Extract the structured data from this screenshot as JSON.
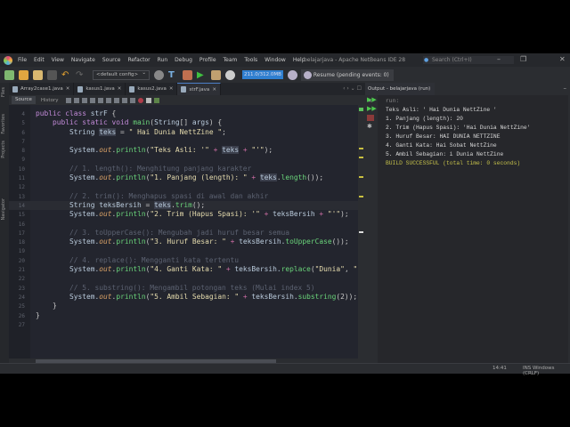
{
  "window": {
    "title": "belajarjava - Apache NetBeans IDE 28",
    "search_placeholder": "Search (Ctrl+I)"
  },
  "menu": [
    "File",
    "Edit",
    "View",
    "Navigate",
    "Source",
    "Refactor",
    "Run",
    "Debug",
    "Profile",
    "Team",
    "Tools",
    "Window",
    "Help"
  ],
  "toolbar": {
    "config": "<default config>",
    "memory": "211.0/312.0MB",
    "resume": "Resume (pending events: 0)"
  },
  "tabs": [
    {
      "label": "Array2case1.java",
      "active": false
    },
    {
      "label": "kasus1.java",
      "active": false
    },
    {
      "label": "kasus2.java",
      "active": false
    },
    {
      "label": "strF.java",
      "active": true
    }
  ],
  "editor_toolbar": {
    "source": "Source",
    "history": "History"
  },
  "left_strip": [
    "Files",
    "Favorites",
    "Projects",
    "Navigator"
  ],
  "code": [
    {
      "n": "4",
      "t": [
        [
          "k",
          "public class "
        ],
        [
          "i",
          "strF "
        ],
        [
          "p",
          "{"
        ]
      ]
    },
    {
      "n": "5",
      "t": [
        [
          "p",
          "    "
        ],
        [
          "k",
          "public static void "
        ],
        [
          "m",
          "main"
        ],
        [
          "p",
          "("
        ],
        [
          "i",
          "String"
        ],
        [
          "p",
          "[] "
        ],
        [
          "i",
          "args"
        ],
        [
          "p",
          ") {"
        ]
      ]
    },
    {
      "n": "6",
      "t": [
        [
          "p",
          "        "
        ],
        [
          "i",
          "String "
        ],
        [
          "h",
          "teks"
        ],
        [
          "p",
          " = "
        ],
        [
          "s",
          "\" Hai Dunia NettZine \""
        ],
        [
          "p",
          ";"
        ]
      ]
    },
    {
      "n": "7",
      "t": []
    },
    {
      "n": "8",
      "t": [
        [
          "p",
          "        "
        ],
        [
          "i",
          "System."
        ],
        [
          "o",
          "out"
        ],
        [
          "p",
          "."
        ],
        [
          "m",
          "println"
        ],
        [
          "p",
          "("
        ],
        [
          "s",
          "\"Teks Asli: '\""
        ],
        [
          "op",
          " + "
        ],
        [
          "h",
          "teks"
        ],
        [
          "op",
          " + "
        ],
        [
          "s",
          "\"'\""
        ],
        [
          "p",
          ");"
        ]
      ]
    },
    {
      "n": "9",
      "t": []
    },
    {
      "n": "10",
      "t": [
        [
          "c",
          "        // 1. length(): Menghitung panjang karakter"
        ]
      ]
    },
    {
      "n": "11",
      "t": [
        [
          "p",
          "        "
        ],
        [
          "i",
          "System."
        ],
        [
          "o",
          "out"
        ],
        [
          "p",
          "."
        ],
        [
          "m",
          "println"
        ],
        [
          "p",
          "("
        ],
        [
          "s",
          "\"1. Panjang (length): \""
        ],
        [
          "op",
          " + "
        ],
        [
          "h",
          "teks"
        ],
        [
          "p",
          "."
        ],
        [
          "m",
          "length"
        ],
        [
          "p",
          "());"
        ]
      ]
    },
    {
      "n": "12",
      "t": []
    },
    {
      "n": "13",
      "t": [
        [
          "c",
          "        // 2. trim(): Menghapus spasi di awal dan akhir"
        ]
      ]
    },
    {
      "n": "14",
      "cur": true,
      "t": [
        [
          "p",
          "        "
        ],
        [
          "i",
          "String teksBersih"
        ],
        [
          "p",
          " = "
        ],
        [
          "h",
          "teks"
        ],
        [
          "p",
          "."
        ],
        [
          "m",
          "trim"
        ],
        [
          "p",
          "();"
        ]
      ]
    },
    {
      "n": "15",
      "t": [
        [
          "p",
          "        "
        ],
        [
          "i",
          "System."
        ],
        [
          "o",
          "out"
        ],
        [
          "p",
          "."
        ],
        [
          "m",
          "println"
        ],
        [
          "p",
          "("
        ],
        [
          "s",
          "\"2. Trim (Hapus Spasi): '\""
        ],
        [
          "op",
          " + "
        ],
        [
          "i",
          "teksBersih"
        ],
        [
          "op",
          " + "
        ],
        [
          "s",
          "\"'\""
        ],
        [
          "p",
          ");"
        ]
      ]
    },
    {
      "n": "16",
      "t": []
    },
    {
      "n": "17",
      "t": [
        [
          "c",
          "        // 3. toUpperCase(): Mengubah jadi huruf besar semua"
        ]
      ]
    },
    {
      "n": "18",
      "t": [
        [
          "p",
          "        "
        ],
        [
          "i",
          "System."
        ],
        [
          "o",
          "out"
        ],
        [
          "p",
          "."
        ],
        [
          "m",
          "println"
        ],
        [
          "p",
          "("
        ],
        [
          "s",
          "\"3. Huruf Besar: \""
        ],
        [
          "op",
          " + "
        ],
        [
          "i",
          "teksBersih."
        ],
        [
          "m",
          "toUpperCase"
        ],
        [
          "p",
          "());"
        ]
      ]
    },
    {
      "n": "19",
      "t": []
    },
    {
      "n": "20",
      "t": [
        [
          "c",
          "        // 4. replace(): Mengganti kata tertentu"
        ]
      ]
    },
    {
      "n": "21",
      "t": [
        [
          "p",
          "        "
        ],
        [
          "i",
          "System."
        ],
        [
          "o",
          "out"
        ],
        [
          "p",
          "."
        ],
        [
          "m",
          "println"
        ],
        [
          "p",
          "("
        ],
        [
          "s",
          "\"4. Ganti Kata: \""
        ],
        [
          "op",
          " + "
        ],
        [
          "i",
          "teksBersih."
        ],
        [
          "m",
          "replace"
        ],
        [
          "p",
          "("
        ],
        [
          "s",
          "\"Dunia\""
        ],
        [
          "p",
          ", "
        ],
        [
          "s",
          "\""
        ]
      ]
    },
    {
      "n": "22",
      "t": []
    },
    {
      "n": "23",
      "t": [
        [
          "c",
          "        // 5. substring(): Mengambil potongan teks (Mulai index 5)"
        ]
      ]
    },
    {
      "n": "24",
      "t": [
        [
          "p",
          "        "
        ],
        [
          "i",
          "System."
        ],
        [
          "o",
          "out"
        ],
        [
          "p",
          "."
        ],
        [
          "m",
          "println"
        ],
        [
          "p",
          "("
        ],
        [
          "s",
          "\"5. Ambil Sebagian: \""
        ],
        [
          "op",
          " + "
        ],
        [
          "i",
          "teksBersih."
        ],
        [
          "m",
          "substring"
        ],
        [
          "p",
          "(2));"
        ]
      ]
    },
    {
      "n": "25",
      "t": [
        [
          "p",
          "    }"
        ]
      ]
    },
    {
      "n": "26",
      "t": [
        [
          "p",
          "}"
        ]
      ]
    },
    {
      "n": "27",
      "t": []
    }
  ],
  "output": {
    "tab": "Output - belajarjava (run)",
    "lines": [
      {
        "cls": "run",
        "text": "run:"
      },
      {
        "cls": "",
        "text": "Teks Asli: ' Hai Dunia NettZine '"
      },
      {
        "cls": "",
        "text": "1. Panjang (length): 20"
      },
      {
        "cls": "",
        "text": "2. Trim (Hapus Spasi): 'Hai Dunia NettZine'"
      },
      {
        "cls": "",
        "text": "3. Huruf Besar: HAI DUNIA NETTZINE"
      },
      {
        "cls": "",
        "text": "4. Ganti Kata: Hai Sobat NettZine"
      },
      {
        "cls": "",
        "text": "5. Ambil Sebagian: i Dunia NettZine"
      },
      {
        "cls": "ok",
        "text": "BUILD SUCCESSFUL (total time: 0 seconds)"
      }
    ]
  },
  "status": {
    "position": "14:41",
    "mode": "INS Windows (CRLF)"
  }
}
